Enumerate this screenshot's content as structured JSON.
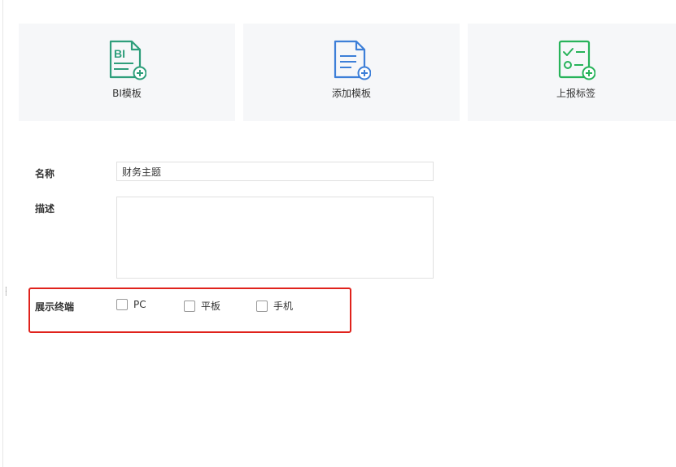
{
  "cards": [
    {
      "label": "BI模板",
      "icon": "bi-template-add-icon",
      "color": "#2e9e7b",
      "icon_text": "BI"
    },
    {
      "label": "添加模板",
      "icon": "document-add-icon",
      "color": "#3d7fd8"
    },
    {
      "label": "上报标签",
      "icon": "checklist-add-icon",
      "color": "#27b35a"
    }
  ],
  "form": {
    "name_label": "名称",
    "name_value": "财务主题",
    "desc_label": "描述",
    "desc_value": "",
    "terminal_label": "展示终端",
    "terminals": [
      {
        "label": "PC",
        "checked": false
      },
      {
        "label": "平板",
        "checked": false
      },
      {
        "label": "手机",
        "checked": false
      }
    ]
  },
  "colors": {
    "highlight": "#e0221c",
    "card_bg": "#f6f7f9"
  }
}
